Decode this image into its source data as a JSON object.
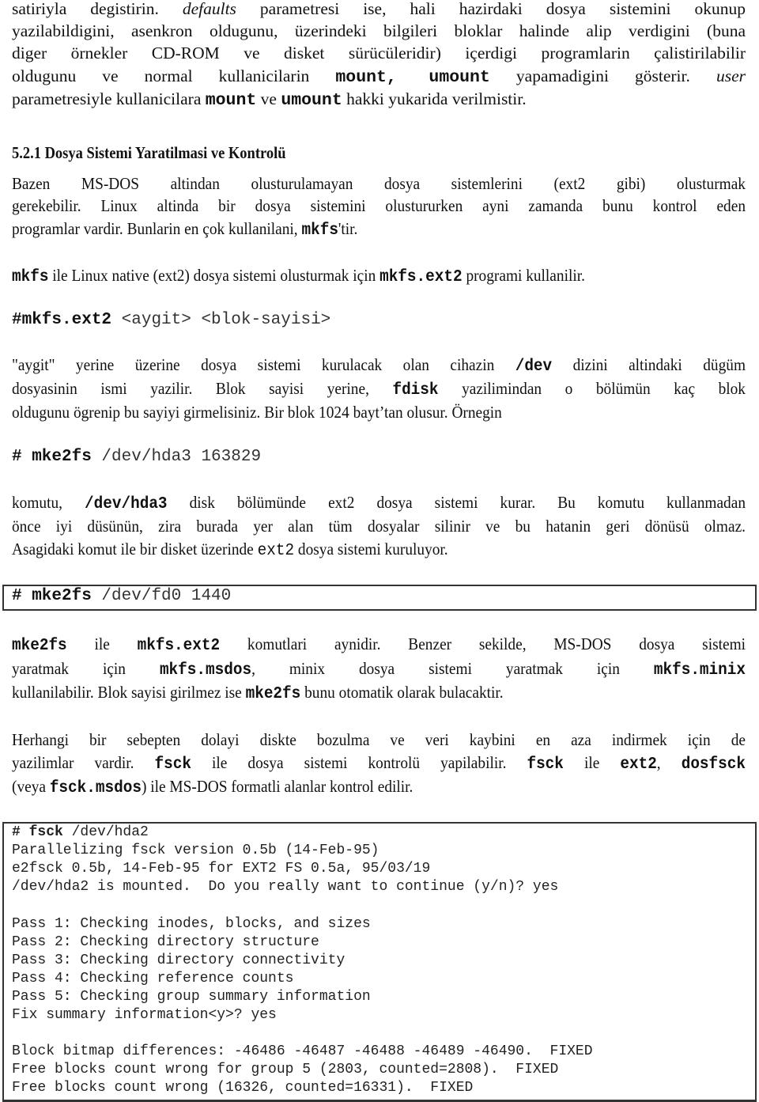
{
  "document": {
    "para1": [
      [
        {
          "t": "satiriyla degistirin. "
        },
        {
          "t": "defaults",
          "s": "i"
        },
        {
          "t": " parametresi ise, hali hazirdaki dosya sistemini okunup"
        }
      ],
      [
        {
          "t": "yazilabildigini, asenkron oldugunu, üzerindeki bilgileri bloklar halinde alip verdigini (buna"
        }
      ],
      [
        {
          "t": "diger örnekler CD-ROM ve disket sürücüleridir) içerdigi programlarin çalistirilabilir"
        }
      ],
      [
        {
          "t": "oldugunu ve normal kullanicilarin "
        },
        {
          "t": "mount, umount",
          "s": "mono b"
        },
        {
          "t": " yapamadigini gösterir. "
        },
        {
          "t": "user",
          "s": "i"
        }
      ],
      [
        {
          "t": "parametresiyle kullanicilara "
        },
        {
          "t": "mount",
          "s": "mono b"
        },
        {
          "t": " ve "
        },
        {
          "t": "umount",
          "s": "mono b"
        },
        {
          "t": " hakki yukarida verilmistir."
        }
      ]
    ],
    "heading": "5.2.1 Dosya Sistemi Yaratilmasi ve Kontrolü",
    "para2": [
      [
        {
          "t": "Bazen MS-DOS altindan olusturulamayan dosya sistemlerini (ext2 gibi) olusturmak"
        }
      ],
      [
        {
          "t": "gerekebilir. Linux altinda bir dosya sistemini olustururken ayni zamanda bunu kontrol eden"
        }
      ],
      [
        {
          "t": "programlar vardir. Bunlarin en çok kullanilani, "
        },
        {
          "t": "mkfs",
          "s": "mono b"
        },
        {
          "t": "'tir."
        }
      ]
    ],
    "para3": [
      [
        {
          "t": "mkfs",
          "s": "mono b"
        },
        {
          "t": " ile Linux native (ext2) dosya sistemi olusturmak için "
        },
        {
          "t": "mkfs.ext2",
          "s": "mono b"
        },
        {
          "t": " programi kullanilir."
        }
      ]
    ],
    "cmd1": [
      [
        {
          "t": "#mkfs.ext2",
          "s": "b"
        },
        {
          "t": " <aygit> <blok-sayisi>",
          "s": "grey"
        }
      ]
    ],
    "para4": [
      [
        {
          "t": "\"aygit\" yerine üzerine dosya sistemi kurulacak olan cihazin "
        },
        {
          "t": "/dev",
          "s": "mono b"
        },
        {
          "t": " dizini altindaki dügüm"
        }
      ],
      [
        {
          "t": "dosyasinin ismi yazilir. Blok sayisi yerine, "
        },
        {
          "t": "fdisk",
          "s": "mono b"
        },
        {
          "t": " yazilimindan o bölümün kaç blok"
        }
      ],
      [
        {
          "t": "oldugunu ögrenip bu sayiyi girmelisiniz. Bir blok 1024 bayt’tan olusur. Örnegin"
        }
      ]
    ],
    "cmd2": [
      [
        {
          "t": "# mke2fs",
          "s": "b"
        },
        {
          "t": " /dev/hda3 163829",
          "s": "grey"
        }
      ]
    ],
    "para5": [
      [
        {
          "t": "komutu, "
        },
        {
          "t": "/dev/hda3",
          "s": "mono b"
        },
        {
          "t": " disk bölümünde ext2 dosya sistemi kurar. Bu komutu kullanmadan"
        }
      ],
      [
        {
          "t": "önce iyi düsünün, zira burada yer alan tüm dosyalar silinir ve bu hatanin geri dönüsü olmaz."
        }
      ],
      [
        {
          "t": "Asagidaki komut ile bir disket üzerinde "
        },
        {
          "t": "ext2",
          "s": "mono"
        },
        {
          "t": " dosya sistemi kuruluyor."
        }
      ]
    ],
    "cmd3": [
      [
        {
          "t": "# mke2fs",
          "s": "b"
        },
        {
          "t": " /dev/fd0 1440",
          "s": "grey"
        }
      ]
    ],
    "para6": [
      [
        {
          "t": "mke2fs",
          "s": "mono b"
        },
        {
          "t": " ile "
        },
        {
          "t": "mkfs.ext2",
          "s": "mono b"
        },
        {
          "t": " komutlari aynidir. Benzer sekilde, MS-DOS dosya sistemi"
        }
      ],
      [
        {
          "t": "yaratmak için "
        },
        {
          "t": "mkfs.msdos",
          "s": "mono b"
        },
        {
          "t": ", minix dosya sistemi yaratmak için "
        },
        {
          "t": "mkfs.minix",
          "s": "mono b"
        }
      ],
      [
        {
          "t": "kullanilabilir. Blok sayisi girilmez ise "
        },
        {
          "t": "mke2fs",
          "s": "mono b"
        },
        {
          "t": " bunu otomatik olarak bulacaktir."
        }
      ]
    ],
    "para7": [
      [
        {
          "t": "Herhangi bir sebepten dolayi diskte bozulma ve veri kaybini en aza indirmek için de"
        }
      ],
      [
        {
          "t": "yazilimlar vardir. "
        },
        {
          "t": "fsck",
          "s": "mono b"
        },
        {
          "t": " ile dosya sistemi kontrolü yapilabilir. "
        },
        {
          "t": "fsck",
          "s": "mono b"
        },
        {
          "t": " ile "
        },
        {
          "t": "ext2",
          "s": "mono b"
        },
        {
          "t": ", "
        },
        {
          "t": "dosfsck",
          "s": "mono b"
        }
      ],
      [
        {
          "t": "(veya "
        },
        {
          "t": "fsck.msdos",
          "s": "mono b"
        },
        {
          "t": ") ile MS-DOS formatli alanlar kontrol edilir."
        }
      ]
    ],
    "terminal": [
      [
        {
          "t": "# fsck",
          "s": "b"
        },
        {
          "t": " /dev/hda2"
        }
      ],
      [
        {
          "t": "Parallelizing fsck version 0.5b (14-Feb-95)"
        }
      ],
      [
        {
          "t": "e2fsck 0.5b, 14-Feb-95 for EXT2 FS 0.5a, 95/03/19"
        }
      ],
      [
        {
          "t": "/dev/hda2 is mounted.  Do you really want to continue (y/n)? yes"
        }
      ],
      [
        {
          "t": ""
        }
      ],
      [
        {
          "t": "Pass 1: Checking inodes, blocks, and sizes"
        }
      ],
      [
        {
          "t": "Pass 2: Checking directory structure"
        }
      ],
      [
        {
          "t": "Pass 3: Checking directory connectivity"
        }
      ],
      [
        {
          "t": "Pass 4: Checking reference counts"
        }
      ],
      [
        {
          "t": "Pass 5: Checking group summary information"
        }
      ],
      [
        {
          "t": "Fix summary information<y>? yes"
        }
      ],
      [
        {
          "t": ""
        }
      ],
      [
        {
          "t": "Block bitmap differences: -46486 -46487 -46488 -46489 -46490.  FIXED"
        }
      ],
      [
        {
          "t": "Free blocks count wrong for group 5 (2803, counted=2808).  FIXED"
        }
      ],
      [
        {
          "t": "Free blocks count wrong (16326, counted=16331).  FIXED"
        }
      ]
    ]
  }
}
